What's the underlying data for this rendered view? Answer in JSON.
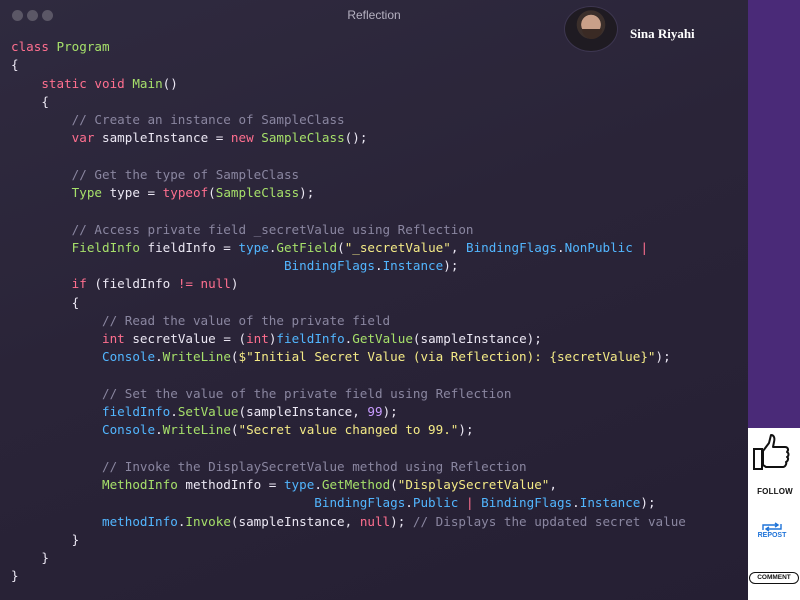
{
  "window": {
    "title": "Reflection"
  },
  "profile": {
    "name": "Sina Riyahi"
  },
  "social": {
    "follow": "FOLLOW",
    "repost": "REPOST",
    "comment": "COMMENT"
  },
  "code_lines": [
    [
      {
        "t": "class ",
        "c": "kw"
      },
      {
        "t": "Program",
        "c": "ty"
      }
    ],
    [
      {
        "t": "{",
        "c": "pl"
      }
    ],
    [
      {
        "t": "    static void ",
        "c": "kw"
      },
      {
        "t": "Main",
        "c": "ty"
      },
      {
        "t": "()",
        "c": "pl"
      }
    ],
    [
      {
        "t": "    {",
        "c": "pl"
      }
    ],
    [
      {
        "t": "        // Create an instance of SampleClass",
        "c": "cmt"
      }
    ],
    [
      {
        "t": "        var ",
        "c": "kw"
      },
      {
        "t": "sampleInstance = ",
        "c": "pl"
      },
      {
        "t": "new ",
        "c": "kw"
      },
      {
        "t": "SampleClass",
        "c": "ty"
      },
      {
        "t": "();",
        "c": "pl"
      }
    ],
    [
      {
        "t": "",
        "c": "pl"
      }
    ],
    [
      {
        "t": "        // Get the type of SampleClass",
        "c": "cmt"
      }
    ],
    [
      {
        "t": "        Type ",
        "c": "ty"
      },
      {
        "t": "type = ",
        "c": "pl"
      },
      {
        "t": "typeof",
        "c": "kw"
      },
      {
        "t": "(",
        "c": "pl"
      },
      {
        "t": "SampleClass",
        "c": "ty"
      },
      {
        "t": ");",
        "c": "pl"
      }
    ],
    [
      {
        "t": "",
        "c": "pl"
      }
    ],
    [
      {
        "t": "        // Access private field _secretValue using Reflection",
        "c": "cmt"
      }
    ],
    [
      {
        "t": "        FieldInfo ",
        "c": "ty"
      },
      {
        "t": "fieldInfo = ",
        "c": "pl"
      },
      {
        "t": "type",
        "c": "mem"
      },
      {
        "t": ".",
        "c": "pl"
      },
      {
        "t": "GetField",
        "c": "ty"
      },
      {
        "t": "(",
        "c": "pl"
      },
      {
        "t": "\"_secretValue\"",
        "c": "str"
      },
      {
        "t": ", ",
        "c": "pl"
      },
      {
        "t": "BindingFlags",
        "c": "mem"
      },
      {
        "t": ".",
        "c": "pl"
      },
      {
        "t": "NonPublic",
        "c": "mem"
      },
      {
        "t": " |",
        "c": "op"
      }
    ],
    [
      {
        "t": "                                    ",
        "c": "pl"
      },
      {
        "t": "BindingFlags",
        "c": "mem"
      },
      {
        "t": ".",
        "c": "pl"
      },
      {
        "t": "Instance",
        "c": "mem"
      },
      {
        "t": ");",
        "c": "pl"
      }
    ],
    [
      {
        "t": "        if ",
        "c": "kw"
      },
      {
        "t": "(fieldInfo ",
        "c": "pl"
      },
      {
        "t": "!= null",
        "c": "kw"
      },
      {
        "t": ")",
        "c": "pl"
      }
    ],
    [
      {
        "t": "        {",
        "c": "pl"
      }
    ],
    [
      {
        "t": "            // Read the value of the private field",
        "c": "cmt"
      }
    ],
    [
      {
        "t": "            int ",
        "c": "kw"
      },
      {
        "t": "secretValue = (",
        "c": "pl"
      },
      {
        "t": "int",
        "c": "kw"
      },
      {
        "t": ")",
        "c": "pl"
      },
      {
        "t": "fieldInfo",
        "c": "mem"
      },
      {
        "t": ".",
        "c": "pl"
      },
      {
        "t": "GetValue",
        "c": "ty"
      },
      {
        "t": "(sampleInstance);",
        "c": "pl"
      }
    ],
    [
      {
        "t": "            Console",
        "c": "mem"
      },
      {
        "t": ".",
        "c": "pl"
      },
      {
        "t": "WriteLine",
        "c": "ty"
      },
      {
        "t": "(",
        "c": "pl"
      },
      {
        "t": "$\"Initial Secret Value (via Reflection): {secretValue}\"",
        "c": "str"
      },
      {
        "t": ");",
        "c": "pl"
      }
    ],
    [
      {
        "t": "",
        "c": "pl"
      }
    ],
    [
      {
        "t": "            // Set the value of the private field using Reflection",
        "c": "cmt"
      }
    ],
    [
      {
        "t": "            fieldInfo",
        "c": "mem"
      },
      {
        "t": ".",
        "c": "pl"
      },
      {
        "t": "SetValue",
        "c": "ty"
      },
      {
        "t": "(sampleInstance, ",
        "c": "pl"
      },
      {
        "t": "99",
        "c": "num"
      },
      {
        "t": ");",
        "c": "pl"
      }
    ],
    [
      {
        "t": "            Console",
        "c": "mem"
      },
      {
        "t": ".",
        "c": "pl"
      },
      {
        "t": "WriteLine",
        "c": "ty"
      },
      {
        "t": "(",
        "c": "pl"
      },
      {
        "t": "\"Secret value changed to 99.\"",
        "c": "str"
      },
      {
        "t": ");",
        "c": "pl"
      }
    ],
    [
      {
        "t": "",
        "c": "pl"
      }
    ],
    [
      {
        "t": "            // Invoke the DisplaySecretValue method using Reflection",
        "c": "cmt"
      }
    ],
    [
      {
        "t": "            MethodInfo ",
        "c": "ty"
      },
      {
        "t": "methodInfo = ",
        "c": "pl"
      },
      {
        "t": "type",
        "c": "mem"
      },
      {
        "t": ".",
        "c": "pl"
      },
      {
        "t": "GetMethod",
        "c": "ty"
      },
      {
        "t": "(",
        "c": "pl"
      },
      {
        "t": "\"DisplaySecretValue\"",
        "c": "str"
      },
      {
        "t": ",",
        "c": "pl"
      }
    ],
    [
      {
        "t": "                                        ",
        "c": "pl"
      },
      {
        "t": "BindingFlags",
        "c": "mem"
      },
      {
        "t": ".",
        "c": "pl"
      },
      {
        "t": "Public",
        "c": "mem"
      },
      {
        "t": " | ",
        "c": "op"
      },
      {
        "t": "BindingFlags",
        "c": "mem"
      },
      {
        "t": ".",
        "c": "pl"
      },
      {
        "t": "Instance",
        "c": "mem"
      },
      {
        "t": ");",
        "c": "pl"
      }
    ],
    [
      {
        "t": "            methodInfo",
        "c": "mem"
      },
      {
        "t": ".",
        "c": "pl"
      },
      {
        "t": "Invoke",
        "c": "ty"
      },
      {
        "t": "(sampleInstance, ",
        "c": "pl"
      },
      {
        "t": "null",
        "c": "kw"
      },
      {
        "t": "); ",
        "c": "pl"
      },
      {
        "t": "// Displays the updated secret value",
        "c": "cmt"
      }
    ],
    [
      {
        "t": "        }",
        "c": "pl"
      }
    ],
    [
      {
        "t": "    }",
        "c": "pl"
      }
    ],
    [
      {
        "t": "}",
        "c": "pl"
      }
    ]
  ]
}
